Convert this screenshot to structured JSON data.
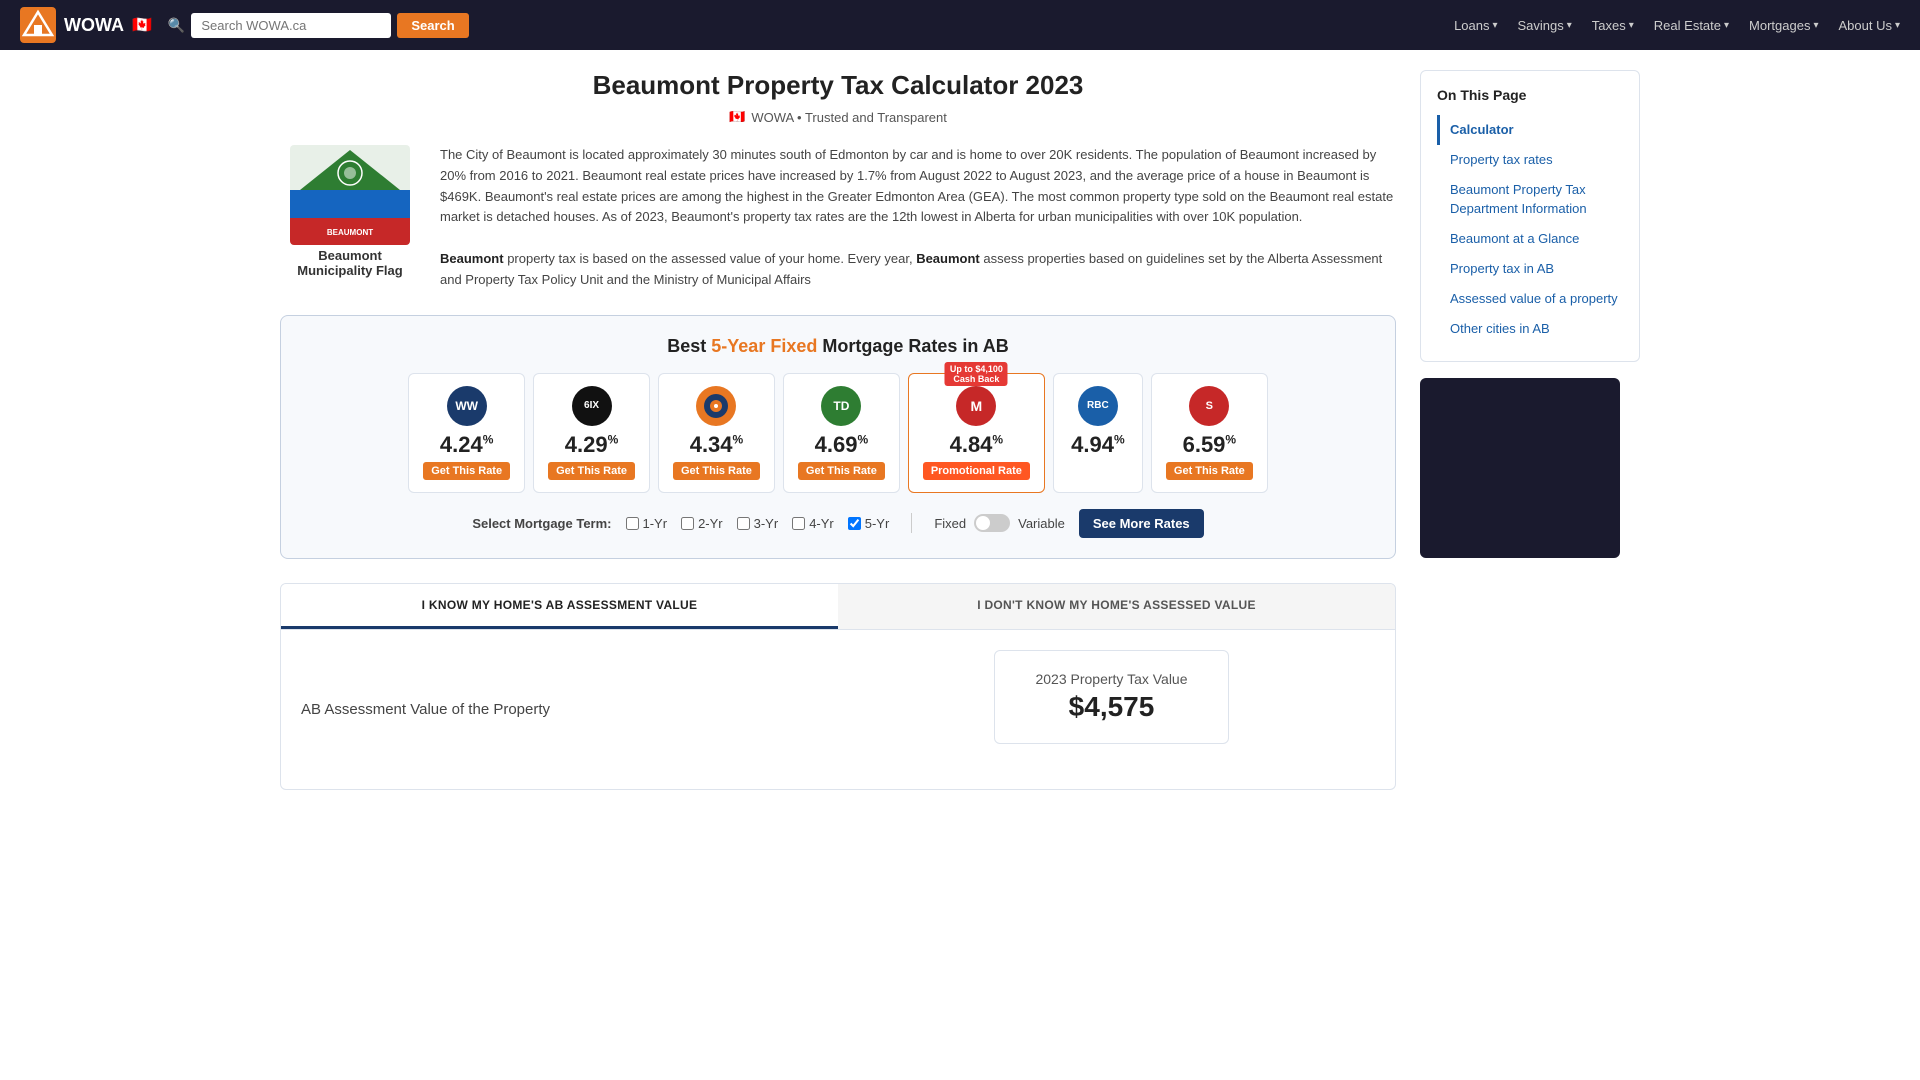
{
  "nav": {
    "logo_text": "WOWA",
    "search_placeholder": "Search WOWA.ca",
    "search_btn": "Search",
    "links": [
      {
        "label": "Loans",
        "has_arrow": true
      },
      {
        "label": "Savings",
        "has_arrow": true
      },
      {
        "label": "Taxes",
        "has_arrow": true
      },
      {
        "label": "Real Estate",
        "has_arrow": true
      },
      {
        "label": "Mortgages",
        "has_arrow": true
      },
      {
        "label": "About Us",
        "has_arrow": true
      }
    ]
  },
  "page": {
    "title": "Beaumont Property Tax Calculator 2023",
    "trusted_badge": "WOWA • Trusted and Transparent",
    "municipality_flag_label": "Beaumont\nMunicipality Flag"
  },
  "intro": {
    "text1": "The City of Beaumont is located approximately 30 minutes south of Edmonton by car and is home to over 20K residents. The population of Beaumont increased by 20% from 2016 to 2021. Beaumont real estate prices have increased by 1.7% from August 2022 to August 2023, and the average price of a house in Beaumont is $469K. Beaumont's real estate prices are among the highest in the Greater Edmonton Area (GEA). The most common property type sold on the Beaumont real estate market is detached houses. As of 2023, Beaumont's property tax rates are the 12th lowest in Alberta for urban municipalities with over 10K population.",
    "text2_bold1": "Beaumont",
    "text2_mid": " property tax is based on the assessed value of your home. Every year, ",
    "text2_bold2": "Beaumont",
    "text2_end": " assess properties based on guidelines set by the Alberta Assessment and Property Tax Policy Unit and the Ministry of Municipal Affairs"
  },
  "mortgage": {
    "title_prefix": "Best ",
    "title_highlight": "5-Year Fixed",
    "title_suffix": " Mortgage Rates in AB",
    "rates": [
      {
        "logo_text": "WW",
        "logo_bg": "#1a3a6b",
        "rate": "4.24",
        "btn_label": "Get This Rate",
        "btn_type": "orange",
        "cashback": null
      },
      {
        "logo_text": "6IX",
        "logo_bg": "#111",
        "rate": "4.29",
        "btn_label": "Get This Rate",
        "btn_type": "orange",
        "cashback": null
      },
      {
        "logo_text": "●",
        "logo_bg": "#e87722",
        "rate": "4.34",
        "btn_label": "Get This Rate",
        "btn_type": "orange",
        "cashback": null
      },
      {
        "logo_text": "TD",
        "logo_bg": "#2e7d32",
        "rate": "4.69",
        "btn_label": "Get This Rate",
        "btn_type": "orange",
        "cashback": null
      },
      {
        "logo_text": "M",
        "logo_bg": "#c62828",
        "rate": "4.84",
        "btn_label": "Promotional Rate",
        "btn_type": "promo",
        "cashback": "Up to $4,100\nCash Back"
      },
      {
        "logo_text": "RBC",
        "logo_bg": "#1a5fa8",
        "rate": "4.94",
        "btn_label": "",
        "btn_type": "none",
        "cashback": null
      },
      {
        "logo_text": "S",
        "logo_bg": "#c62828",
        "rate": "6.59",
        "btn_label": "Get This Rate",
        "btn_type": "orange",
        "cashback": null
      }
    ],
    "term_label": "Select Mortgage Term:",
    "terms": [
      "1-Yr",
      "2-Yr",
      "3-Yr",
      "4-Yr",
      "5-Yr"
    ],
    "terms_checked": [
      false,
      false,
      false,
      false,
      true
    ],
    "toggle_fixed": "Fixed",
    "toggle_variable": "Variable",
    "see_more_btn": "See More Rates"
  },
  "calc": {
    "tab1_label": "I KNOW MY HOME'S AB ASSESSMENT VALUE",
    "tab2_label": "I DON'T KNOW MY HOME'S ASSESSED VALUE",
    "active_tab": 0,
    "left_label": "AB Assessment Value of the Property",
    "tax_value_label": "2023 Property Tax Value",
    "tax_value_amount": "$4,575"
  },
  "sidebar": {
    "on_this_page_title": "On This Page",
    "items": [
      {
        "label": "Calculator",
        "active": true
      },
      {
        "label": "Property tax rates",
        "active": false
      },
      {
        "label": "Beaumont Property Tax Department Information",
        "active": false
      },
      {
        "label": "Beaumont at a Glance",
        "active": false
      },
      {
        "label": "Property tax in AB",
        "active": false
      },
      {
        "label": "Assessed value of a property",
        "active": false
      },
      {
        "label": "Other cities in AB",
        "active": false
      }
    ]
  }
}
